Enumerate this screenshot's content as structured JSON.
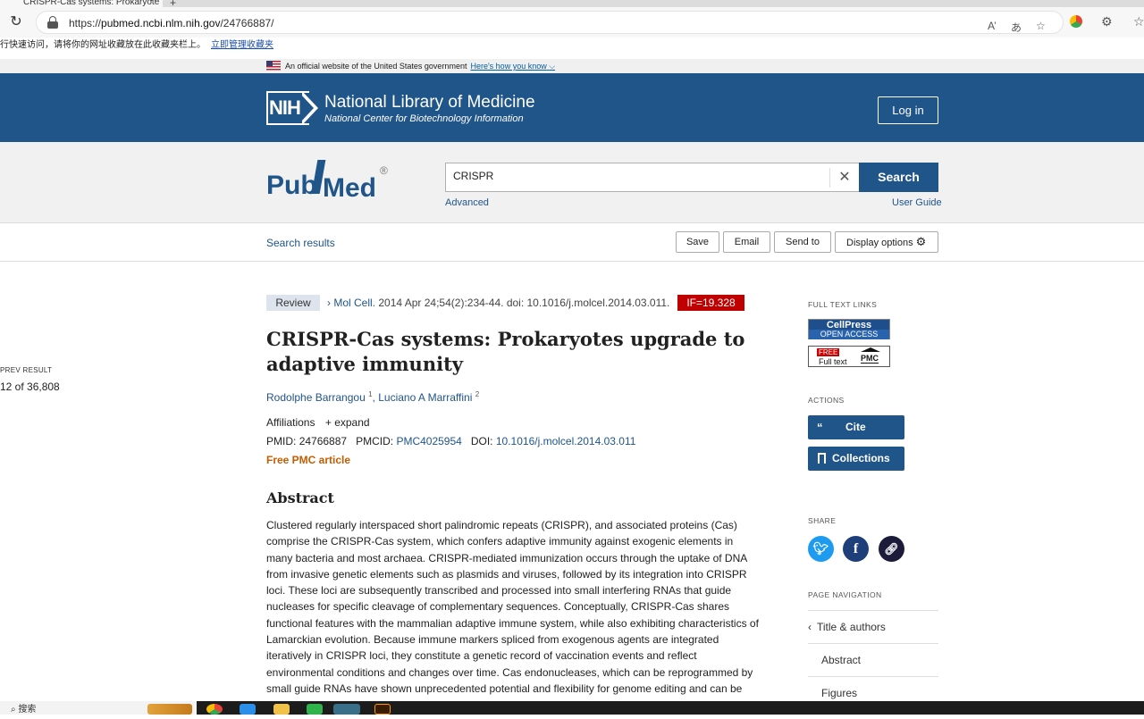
{
  "browser": {
    "tab_title": "CRISPR-Cas systems: Prokaryote",
    "tab_close": "✕",
    "new_tab": "+",
    "url_prefix": "https://",
    "url_domain": "pubmed.ncbi.nlm.nih.gov",
    "url_path": "/24766887/",
    "favbar_text": "行快速访问，请将你的网址收藏放在此收藏夹栏上。",
    "favbar_link": "立即管理收藏夹"
  },
  "gov_banner": {
    "text": "An official website of the United States government",
    "link": "Here's how you know"
  },
  "nih": {
    "logo": "NIH",
    "title": "National Library of Medicine",
    "subtitle": "National Center for Biotechnology Information",
    "login": "Log in"
  },
  "pubmed": {
    "logo_pub": "Pub",
    "logo_med": "Med",
    "logo_reg": "®",
    "search_value": "CRISPR",
    "search_button": "Search",
    "advanced": "Advanced",
    "user_guide": "User Guide"
  },
  "toolbar": {
    "search_results": "Search results",
    "save": "Save",
    "email": "Email",
    "send_to": "Send to",
    "display_options": "Display options"
  },
  "left": {
    "prev_label": "PREV RESULT",
    "prev_count": "12 of 36,808"
  },
  "article": {
    "badge": "Review",
    "journal": "Mol Cell.",
    "citation": "2014 Apr 24;54(2):234-44. doi: 10.1016/j.molcel.2014.03.011.",
    "impact_factor": "IF=19.328",
    "title": "CRISPR-Cas systems: Prokaryotes upgrade to adaptive immunity",
    "authors": [
      {
        "name": "Rodolphe Barrangou",
        "sup": "1"
      },
      {
        "name": "Luciano A Marraffini",
        "sup": "2"
      }
    ],
    "affiliations_label": "Affiliations",
    "expand_label": "expand",
    "pmid_label": "PMID:",
    "pmid": "24766887",
    "pmcid_label": "PMCID:",
    "pmcid": "PMC4025954",
    "doi_label": "DOI:",
    "doi": "10.1016/j.molcel.2014.03.011",
    "free_pmc": "Free PMC article",
    "abstract_heading": "Abstract",
    "abstract": "Clustered regularly interspaced short palindromic repeats (CRISPR), and associated proteins (Cas) comprise the CRISPR-Cas system, which confers adaptive immunity against exogenic elements in many bacteria and most archaea. CRISPR-mediated immunization occurs through the uptake of DNA from invasive genetic elements such as plasmids and viruses, followed by its integration into CRISPR loci. These loci are subsequently transcribed and processed into small interfering RNAs that guide nucleases for specific cleavage of complementary sequences. Conceptually, CRISPR-Cas shares functional features with the mammalian adaptive immune system, while also exhibiting characteristics of Lamarckian evolution. Because immune markers spliced from exogenous agents are integrated iteratively in CRISPR loci, they constitute a genetic record of vaccination events and reflect environmental conditions and changes over time. Cas endonucleases, which can be reprogrammed by small guide RNAs have shown unprecedented potential and flexibility for genome editing and can be"
  },
  "sidebar": {
    "full_text_label": "FULL TEXT LINKS",
    "cellpress_top": "CellPress",
    "cellpress_bottom": "OPEN ACCESS",
    "pmc_free": "FREE",
    "pmc_fulltext": "Full text",
    "pmc_logo": "PMC",
    "actions_label": "ACTIONS",
    "cite": "Cite",
    "collections": "Collections",
    "share_label": "SHARE",
    "page_nav_label": "PAGE NAVIGATION",
    "nav_items": [
      "Title & authors",
      "Abstract",
      "Figures"
    ]
  },
  "taskbar": {
    "search": "搜索"
  },
  "colors": {
    "nih_blue": "#20558a",
    "if_red": "#c00000",
    "free_pmc_orange": "#c65c00",
    "twitter": "#1d9bf0",
    "facebook": "#1f3f7a",
    "link_share": "#1c1c3a"
  }
}
